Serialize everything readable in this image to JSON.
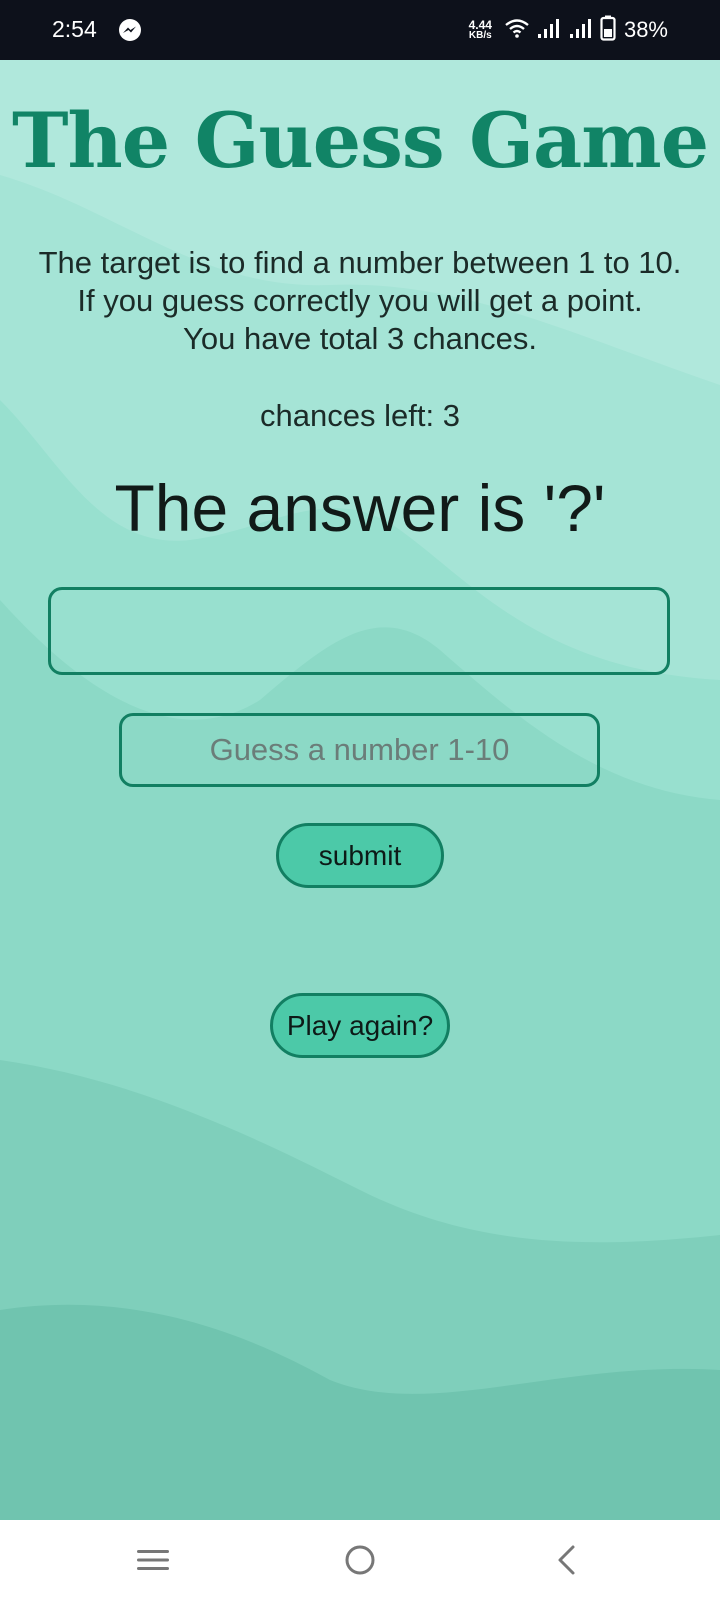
{
  "status_bar": {
    "time": "2:54",
    "net_speed_value": "4.44",
    "net_speed_unit": "KB/s",
    "battery_percent": "38%",
    "icons": [
      "messenger-icon",
      "wifi-icon",
      "signal-icon",
      "signal-icon",
      "battery-icon"
    ]
  },
  "game": {
    "title": "The Guess Game",
    "description_line1": "The target is to find a number between 1 to 10.",
    "description_line2": "If you guess correctly you will get a point.",
    "description_line3": "You have total 3 chances.",
    "chances_label": "chances left: 3",
    "answer_text": "The answer is '?'",
    "result_value": "",
    "guess_input_value": "",
    "guess_input_placeholder": "Guess a number 1-10",
    "submit_label": "submit",
    "play_again_label": "Play again?"
  },
  "nav_bar": {
    "icons": [
      "menu-icon",
      "home-icon",
      "back-icon"
    ]
  },
  "colors": {
    "status_bar_bg": "#0d111b",
    "title": "#118466",
    "border": "#127f62",
    "button_fill": "#4cc9a8",
    "background": "#b0e8dc"
  }
}
